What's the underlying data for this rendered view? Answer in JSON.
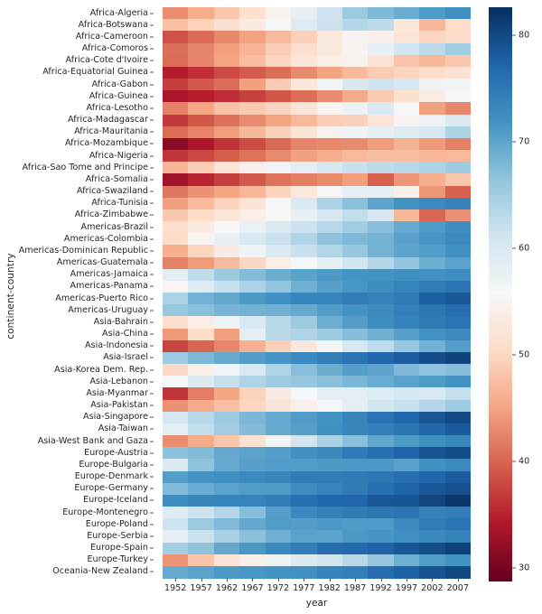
{
  "figure": {
    "type": "heatmap",
    "ylabel": "continent-country",
    "xlabel": "year",
    "colormap": "RdBu",
    "colorbar": {
      "vmin": 28.8,
      "vmax": 82.6,
      "ticks": [
        30,
        40,
        50,
        60,
        70,
        80
      ],
      "orientation": "vertical"
    }
  },
  "chart_data": {
    "type": "heatmap",
    "title": "",
    "xlabel": "year",
    "ylabel": "continent-country",
    "colormap": "RdBu",
    "vmin": 28.8,
    "vmax": 82.6,
    "cbar_ticks": [
      30,
      40,
      50,
      60,
      70,
      80
    ],
    "x": [
      1952,
      1957,
      1962,
      1967,
      1972,
      1977,
      1982,
      1987,
      1992,
      1997,
      2002,
      2007
    ],
    "xtick_labels": [
      "1952",
      "1957",
      "1962",
      "1967",
      "1972",
      "1977",
      "1982",
      "1987",
      "1992",
      "1997",
      "2002",
      "2007"
    ],
    "y": [
      "Africa-Algeria",
      "Africa-Botswana",
      "Africa-Cameroon",
      "Africa-Comoros",
      "Africa-Cote d'Ivoire",
      "Africa-Equatorial Guinea",
      "Africa-Gabon",
      "Africa-Guinea",
      "Africa-Lesotho",
      "Africa-Madagascar",
      "Africa-Mauritania",
      "Africa-Mozambique",
      "Africa-Nigeria",
      "Africa-Sao Tome and Principe",
      "Africa-Somalia",
      "Africa-Swaziland",
      "Africa-Tunisia",
      "Africa-Zimbabwe",
      "Americas-Brazil",
      "Americas-Colombia",
      "Americas-Dominican Republic",
      "Americas-Guatemala",
      "Americas-Jamaica",
      "Americas-Panama",
      "Americas-Puerto Rico",
      "Americas-Uruguay",
      "Asia-Bahrain",
      "Asia-China",
      "Asia-Indonesia",
      "Asia-Israel",
      "Asia-Korea Dem. Rep.",
      "Asia-Lebanon",
      "Asia-Myanmar",
      "Asia-Pakistan",
      "Asia-Singapore",
      "Asia-Taiwan",
      "Asia-West Bank and Gaza",
      "Europe-Austria",
      "Europe-Bulgaria",
      "Europe-Denmark",
      "Europe-Germany",
      "Europe-Iceland",
      "Europe-Montenegro",
      "Europe-Poland",
      "Europe-Serbia",
      "Europe-Spain",
      "Europe-Turkey",
      "Oceania-New Zealand"
    ],
    "values": [
      [
        43.08,
        45.69,
        48.3,
        51.41,
        54.52,
        58.01,
        61.37,
        65.8,
        67.74,
        69.15,
        70.99,
        72.3
      ],
      [
        47.62,
        49.62,
        51.52,
        53.3,
        56.02,
        59.32,
        61.48,
        63.62,
        62.75,
        52.56,
        46.63,
        50.73
      ],
      [
        38.52,
        40.43,
        42.64,
        44.8,
        47.01,
        49.35,
        52.96,
        54.99,
        54.31,
        52.2,
        49.86,
        50.43
      ],
      [
        40.72,
        42.46,
        44.47,
        46.47,
        48.94,
        50.94,
        52.93,
        54.93,
        57.94,
        60.66,
        62.97,
        65.15
      ],
      [
        40.48,
        42.47,
        44.93,
        47.35,
        49.8,
        52.37,
        53.98,
        54.66,
        52.04,
        47.99,
        46.83,
        48.33
      ],
      [
        34.48,
        35.98,
        37.93,
        39.17,
        40.67,
        42.82,
        44.88,
        47.05,
        48.83,
        49.83,
        50.65,
        51.58
      ],
      [
        37.0,
        38.99,
        40.49,
        44.6,
        48.69,
        52.79,
        56.56,
        60.19,
        61.37,
        60.46,
        56.76,
        56.74
      ],
      [
        33.61,
        34.56,
        35.75,
        37.2,
        38.84,
        40.76,
        42.89,
        45.55,
        48.58,
        51.46,
        53.68,
        56.01
      ],
      [
        42.14,
        45.05,
        47.75,
        48.49,
        49.77,
        52.08,
        55.08,
        57.18,
        59.69,
        55.56,
        44.59,
        42.59
      ],
      [
        36.68,
        38.87,
        40.85,
        42.88,
        44.85,
        46.88,
        48.97,
        49.35,
        52.21,
        54.98,
        57.29,
        59.44
      ],
      [
        40.54,
        42.34,
        44.38,
        46.77,
        49.35,
        51.96,
        54.54,
        56.7,
        58.28,
        59.19,
        60.43,
        64.16
      ],
      [
        31.29,
        33.78,
        36.16,
        38.1,
        40.33,
        42.43,
        42.79,
        42.86,
        44.28,
        46.34,
        44.03,
        42.08
      ],
      [
        36.32,
        37.8,
        39.36,
        41.04,
        42.82,
        44.65,
        45.83,
        46.89,
        47.47,
        47.46,
        46.61,
        46.86
      ],
      [
        46.47,
        48.95,
        51.89,
        54.43,
        56.48,
        58.55,
        60.35,
        61.73,
        62.74,
        63.31,
        64.34,
        65.53
      ],
      [
        32.98,
        34.98,
        36.99,
        38.98,
        40.97,
        41.97,
        42.96,
        44.5,
        39.66,
        43.8,
        45.94,
        48.16
      ],
      [
        41.41,
        43.42,
        44.99,
        46.63,
        49.55,
        52.54,
        55.56,
        57.68,
        58.09,
        54.29,
        43.87,
        39.61
      ],
      [
        44.6,
        47.1,
        49.58,
        52.05,
        55.6,
        59.84,
        64.05,
        66.89,
        70.0,
        71.97,
        73.04,
        73.92
      ],
      [
        48.45,
        50.47,
        52.36,
        53.99,
        55.63,
        57.67,
        60.36,
        62.35,
        60.38,
        46.81,
        39.99,
        43.49
      ],
      [
        50.92,
        53.29,
        55.67,
        57.63,
        59.5,
        61.49,
        63.34,
        65.21,
        67.06,
        69.39,
        71.01,
        72.39
      ],
      [
        50.64,
        55.12,
        57.86,
        59.96,
        61.62,
        63.84,
        66.65,
        67.77,
        68.42,
        70.31,
        71.68,
        72.89
      ],
      [
        45.93,
        49.83,
        53.46,
        56.75,
        59.63,
        61.79,
        63.73,
        66.02,
        68.46,
        69.96,
        70.85,
        72.24
      ],
      [
        42.02,
        44.14,
        46.95,
        50.02,
        53.74,
        56.03,
        58.14,
        60.78,
        63.37,
        66.32,
        68.98,
        70.26
      ],
      [
        58.53,
        62.61,
        65.61,
        67.51,
        69.0,
        70.11,
        71.21,
        71.77,
        71.77,
        72.26,
        72.05,
        72.57
      ],
      [
        55.19,
        59.2,
        61.82,
        64.07,
        66.22,
        68.68,
        70.47,
        71.52,
        72.46,
        73.74,
        74.71,
        75.54
      ],
      [
        64.28,
        68.54,
        69.62,
        71.1,
        72.16,
        73.44,
        73.75,
        74.63,
        73.91,
        74.92,
        77.78,
        78.75
      ],
      [
        66.07,
        67.04,
        68.25,
        68.47,
        68.67,
        69.48,
        70.81,
        71.92,
        72.75,
        74.22,
        75.31,
        76.38
      ],
      [
        50.94,
        53.83,
        56.92,
        59.92,
        63.3,
        65.59,
        69.05,
        70.75,
        72.6,
        73.93,
        74.8,
        75.64
      ],
      [
        44.0,
        50.55,
        44.5,
        58.38,
        63.12,
        63.97,
        65.53,
        67.27,
        68.69,
        70.43,
        72.03,
        72.96
      ],
      [
        37.47,
        39.92,
        42.52,
        45.96,
        49.2,
        52.7,
        56.16,
        60.14,
        62.68,
        66.04,
        68.59,
        70.65
      ],
      [
        65.39,
        67.84,
        69.39,
        70.75,
        71.63,
        73.06,
        74.45,
        75.6,
        76.93,
        78.27,
        79.7,
        80.75
      ],
      [
        50.06,
        54.08,
        56.66,
        59.94,
        63.98,
        67.16,
        69.1,
        70.65,
        69.98,
        67.73,
        66.66,
        67.3
      ],
      [
        55.93,
        59.49,
        62.09,
        63.87,
        65.42,
        66.1,
        66.98,
        67.93,
        69.29,
        70.27,
        71.03,
        71.99
      ],
      [
        36.32,
        41.9,
        45.11,
        49.38,
        53.07,
        56.06,
        58.06,
        58.34,
        59.32,
        60.33,
        59.91,
        62.07
      ],
      [
        43.44,
        45.56,
        47.67,
        49.8,
        51.93,
        54.04,
        56.16,
        58.25,
        60.84,
        61.82,
        63.61,
        65.48
      ],
      [
        60.4,
        63.18,
        65.8,
        67.95,
        69.52,
        70.8,
        71.76,
        73.56,
        75.79,
        77.16,
        78.77,
        79.97
      ],
      [
        58.5,
        62.4,
        65.2,
        67.5,
        69.39,
        70.59,
        72.16,
        73.4,
        74.26,
        75.25,
        76.99,
        78.4
      ],
      [
        43.16,
        45.67,
        48.13,
        51.63,
        56.53,
        60.77,
        64.41,
        67.05,
        69.72,
        71.1,
        72.37,
        73.42
      ],
      [
        66.8,
        67.48,
        69.54,
        70.14,
        70.63,
        72.17,
        73.18,
        74.94,
        76.04,
        77.51,
        78.98,
        79.83
      ],
      [
        59.6,
        66.61,
        69.51,
        70.42,
        70.9,
        70.81,
        71.08,
        71.34,
        71.19,
        70.32,
        72.14,
        73.01
      ],
      [
        70.78,
        71.81,
        72.35,
        72.96,
        73.47,
        74.69,
        74.63,
        74.8,
        75.33,
        76.11,
        77.18,
        78.33
      ],
      [
        67.5,
        69.1,
        70.3,
        70.8,
        71.0,
        72.5,
        73.8,
        74.85,
        76.07,
        77.34,
        78.67,
        79.41
      ],
      [
        72.49,
        73.47,
        73.68,
        73.73,
        74.46,
        76.11,
        76.99,
        77.23,
        78.77,
        78.95,
        80.5,
        81.76
      ],
      [
        59.16,
        61.45,
        63.73,
        67.18,
        70.64,
        73.07,
        74.1,
        74.86,
        75.19,
        75.44,
        73.98,
        74.54
      ],
      [
        61.31,
        65.77,
        67.64,
        69.61,
        70.85,
        70.67,
        71.32,
        70.98,
        70.99,
        72.75,
        74.67,
        75.56
      ],
      [
        57.99,
        61.68,
        64.53,
        66.91,
        68.7,
        70.3,
        70.16,
        71.22,
        71.66,
        72.23,
        73.21,
        74.0
      ],
      [
        64.94,
        66.66,
        69.69,
        71.44,
        73.06,
        74.39,
        76.3,
        76.9,
        77.57,
        78.77,
        79.78,
        80.94
      ],
      [
        43.59,
        48.08,
        52.1,
        54.34,
        57.0,
        59.51,
        61.04,
        63.11,
        66.15,
        68.84,
        70.85,
        71.78
      ],
      [
        69.39,
        70.26,
        71.24,
        71.52,
        71.89,
        72.22,
        73.84,
        74.32,
        76.33,
        77.55,
        79.11,
        80.2
      ]
    ]
  }
}
